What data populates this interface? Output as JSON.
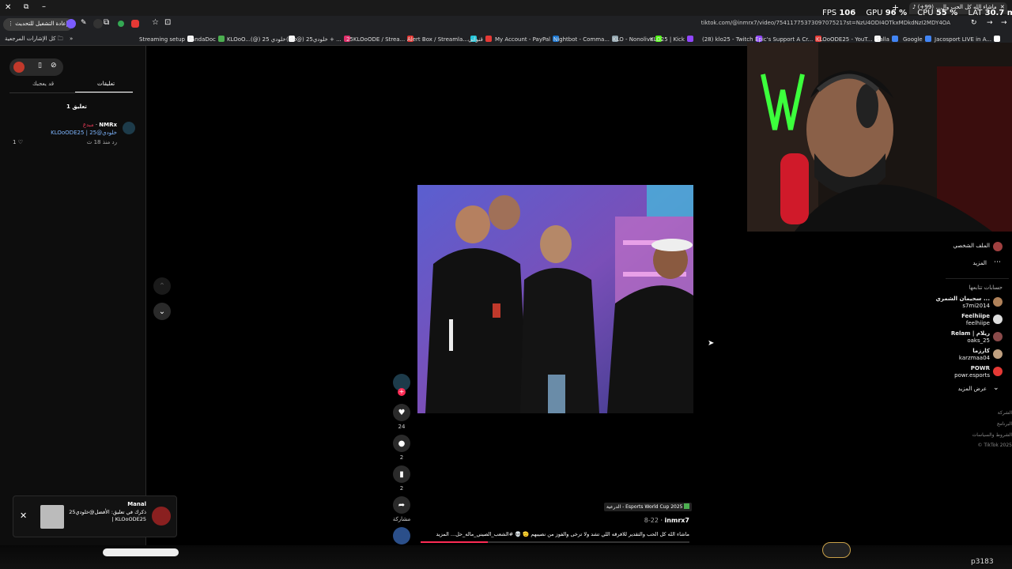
{
  "browser": {
    "tab_title": "ماشاء الله كل الحب وال... (99+)",
    "tab_count_badge": "99+",
    "url": "tiktok.com/@inmrx7/video/75411775373097075217st=NzU4ODI4OTkxMDkdNzI2MDY4OA",
    "reload_update_label": "إعادة التشغيل للتحديث",
    "all_bookmarks_label": "كل الإشارات المرجعية",
    "perf": {
      "fps_label": "FPS",
      "fps": "106",
      "gpu_label": "GPU",
      "gpu": "96 %",
      "cpu_label": "CPU",
      "cpu": "55 %",
      "lat_label": "LAT",
      "lat": "30.7 ms"
    },
    "bookmarks": [
      {
        "label": "Streaming setup",
        "color": "#ffffff"
      },
      {
        "label": "PandaDoc",
        "color": "#4caf50"
      },
      {
        "label": "KLOoO...(@) 25 خلودي",
        "color": "#ffffff"
      },
      {
        "label": "(klo@) 25خلودي + ...",
        "color": "#e1306c"
      },
      {
        "label": "25KLOoODE / Strea...",
        "color": "#e53935"
      },
      {
        "label": "Alert Box / Streamla...",
        "color": "#26c6da"
      },
      {
        "label": "قنواتي",
        "color": "#e53935"
      },
      {
        "label": "My Account - PayPal",
        "color": "#1976d2"
      },
      {
        "label": "Nightbot - Comma...",
        "color": "#90a4ae"
      },
      {
        "label": "KLO - Nonolive",
        "color": "#53fc18"
      },
      {
        "label": "KLO25 | Kick",
        "color": "#9146ff"
      },
      {
        "label": "(28) klo25 - Twitch",
        "color": "#9146ff"
      },
      {
        "label": "Epic's Support A Cr...",
        "color": "#e53935"
      },
      {
        "label": "KLOoODE25 - YouT...",
        "color": "#ffffff"
      },
      {
        "label": "Salla",
        "color": "#4285f4"
      },
      {
        "label": "Google",
        "color": "#4285f4"
      },
      {
        "label": "Jacosport LIVE in A...",
        "color": "#ffffff"
      }
    ]
  },
  "comments_panel": {
    "tab_comments": "تعليقات",
    "tab_you_may_like": "قد يعجبك",
    "comment_count": "1 تعليق",
    "comment": {
      "author": "NMRx",
      "creator_tag": "مبدع",
      "text": "KLOoODE25 | خلودي@25",
      "time": "منذ 18 ث",
      "reply_label": "رد",
      "likes": "1"
    }
  },
  "video": {
    "likes": "24",
    "comments": "2",
    "saves": "2",
    "share_label": "مشاركة",
    "tag_label": "الدرعية - Esports World Cup 2025",
    "author": "inmrx7",
    "date": "8-22",
    "caption": "ماشاء الله كل الحب والتقدير للافرقه اللي تشد ولا ترخى والفوز من نصيبهم 🫡 💀 #الشعب_الصيني_ماله_حل... المزيد"
  },
  "right_sidebar": {
    "profile_label": "الملف الشخصي",
    "more_label": "المزيد",
    "following_title": "حسابات تتابعها",
    "following": [
      {
        "name": "سحيمان الشمري ...",
        "handle": "s7mi2014",
        "color": "#b0825a"
      },
      {
        "name": "Feelhiipe",
        "handle": "feelhiipe",
        "color": "#dddddd"
      },
      {
        "name": "Relam | ريلام",
        "handle": "oaks_25",
        "color": "#8a4a4a"
      },
      {
        "name": "كارزما",
        "handle": "karzmaa04",
        "color": "#c0a080"
      },
      {
        "name": "POWR",
        "handle": "powr.esports",
        "color": "#e53935"
      }
    ],
    "show_more": "عرض المزيد",
    "footer": [
      "الشركة",
      "البرنامج",
      "الشروط والسياسات",
      "© TikTok 2025"
    ]
  },
  "notification": {
    "name": "Manal",
    "text": "ذكرك في تعليق: الأفضل@خلودي25 | KLOoODE25"
  },
  "overlay": {
    "viewer_id": "p3183"
  }
}
